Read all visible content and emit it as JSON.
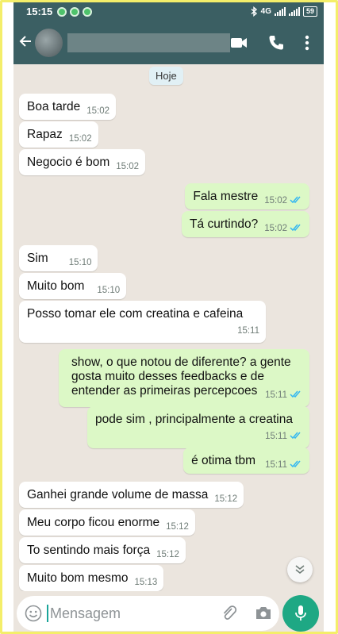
{
  "status_bar": {
    "time": "15:15",
    "network": "4G",
    "battery": "59"
  },
  "header": {
    "contact_name": ""
  },
  "chat": {
    "date_chip": "Hoje",
    "messages": [
      {
        "dir": "in",
        "text": "Boa tarde",
        "time": "15:02"
      },
      {
        "dir": "in",
        "text": "Rapaz",
        "time": "15:02"
      },
      {
        "dir": "in",
        "text": "Negocio é bom",
        "time": "15:02"
      },
      {
        "dir": "out",
        "text": "Fala mestre",
        "time": "15:02",
        "read": true
      },
      {
        "dir": "out",
        "text": "Tá curtindo?",
        "time": "15:02",
        "read": true
      },
      {
        "dir": "in",
        "text": "Sim",
        "time": "15:10"
      },
      {
        "dir": "in",
        "text": "Muito bom",
        "time": "15:10"
      },
      {
        "dir": "in",
        "text": "Posso tomar ele com creatina e cafeina",
        "time": "15:11"
      },
      {
        "dir": "out",
        "text": "show, o que notou de diferente? a gente gosta muito desses feedbacks e de entender as primeiras percepcoes",
        "time": "15:11",
        "read": true
      },
      {
        "dir": "out",
        "text": "pode sim , principalmente a creatina",
        "time": "15:11",
        "read": true
      },
      {
        "dir": "out",
        "text": "é otima tbm",
        "time": "15:11",
        "read": true
      },
      {
        "dir": "in",
        "text": "Ganhei grande volume de massa",
        "time": "15:12"
      },
      {
        "dir": "in",
        "text": "Meu corpo ficou enorme",
        "time": "15:12"
      },
      {
        "dir": "in",
        "text": "To sentindo mais força",
        "time": "15:12"
      },
      {
        "dir": "in",
        "text": "Muito bom mesmo",
        "time": "15:13"
      }
    ]
  },
  "composer": {
    "placeholder": "Mensagem"
  },
  "colors": {
    "header": "#3b5f63",
    "chat_background": "#ebe5de",
    "outgoing_bubble": "#dcf8c6",
    "incoming_bubble": "#ffffff",
    "read_ticks": "#34b7f1",
    "mic_button": "#1ea884"
  },
  "icons": [
    "back-arrow-icon",
    "video-call-icon",
    "phone-icon",
    "more-options-icon",
    "emoji-icon",
    "attach-icon",
    "camera-icon",
    "mic-icon",
    "scroll-down-icon",
    "double-check-icon"
  ]
}
